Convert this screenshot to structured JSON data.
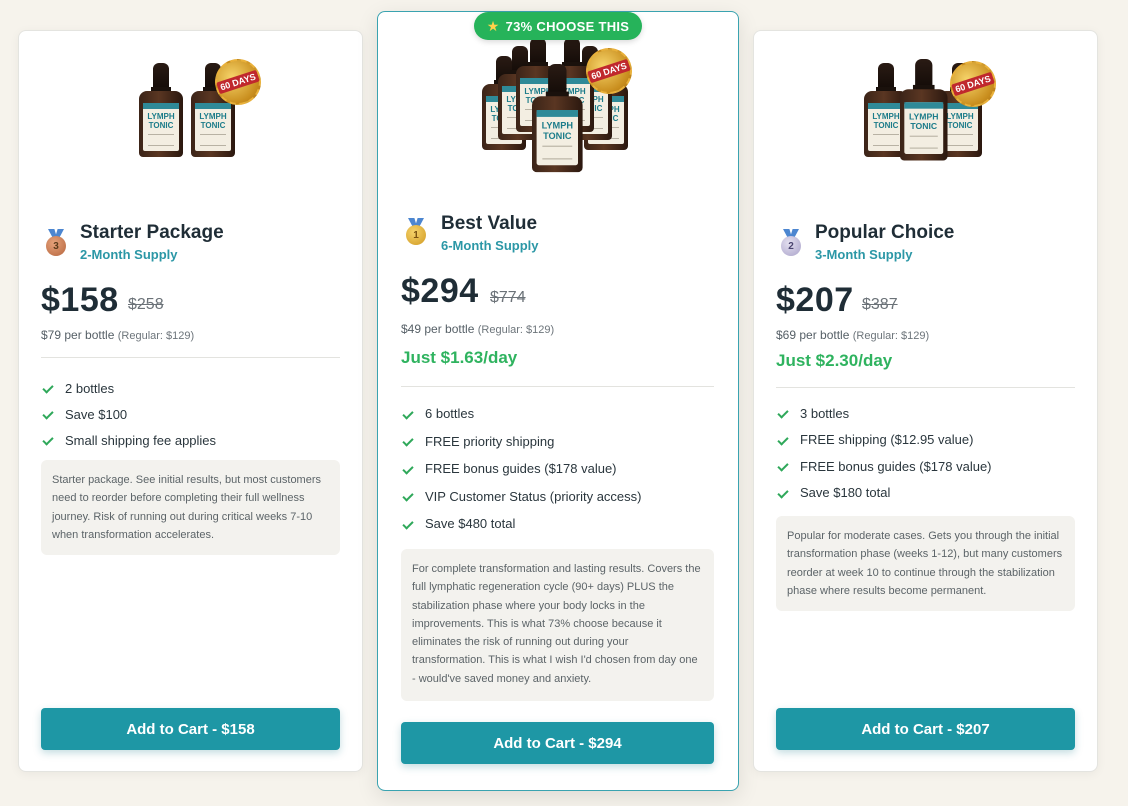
{
  "popular_badge": {
    "icon": "star-icon",
    "label": "73% CHOOSE THIS"
  },
  "bottle_label": {
    "top": "LYMPH",
    "bottom": "TONIC"
  },
  "seal_text": "60 DAYS",
  "colors": {
    "accent": "#1e97a5",
    "highlight_border": "#3aa3b0",
    "green": "#2fb35f",
    "badge": "#26b35a"
  },
  "plans": [
    {
      "medal": "bronze-medal-icon",
      "medal_rank": "3",
      "name": "Starter Package",
      "supply": "2-Month Supply",
      "price": "$158",
      "old_price": "$258",
      "per_bottle": "$79 per bottle",
      "regular": "(Regular: $129)",
      "per_day": "",
      "features": [
        "2 bottles",
        "Save $100",
        "Small shipping fee applies"
      ],
      "note": "Starter package. See initial results, but most customers need to reorder before completing their full wellness journey. Risk of running out during critical weeks 7-10 when transformation accelerates.",
      "cta": "Add to Cart - $158"
    },
    {
      "medal": "gold-medal-icon",
      "medal_rank": "1",
      "name": "Best Value",
      "supply": "6-Month Supply",
      "price": "$294",
      "old_price": "$774",
      "per_bottle": "$49 per bottle",
      "regular": "(Regular: $129)",
      "per_day": "Just $1.63/day",
      "features": [
        "6 bottles",
        "FREE priority shipping",
        "FREE bonus guides ($178 value)",
        "VIP Customer Status (priority access)",
        "Save $480 total"
      ],
      "note": "For complete transformation and lasting results. Covers the full lymphatic regeneration cycle (90+ days) PLUS the stabilization phase where your body locks in the improvements. This is what 73% choose because it eliminates the risk of running out during your transformation. This is what I wish I'd chosen from day one - would've saved money and anxiety.",
      "cta": "Add to Cart - $294"
    },
    {
      "medal": "silver-medal-icon",
      "medal_rank": "2",
      "name": "Popular Choice",
      "supply": "3-Month Supply",
      "price": "$207",
      "old_price": "$387",
      "per_bottle": "$69 per bottle",
      "regular": "(Regular: $129)",
      "per_day": "Just $2.30/day",
      "features": [
        "3 bottles",
        "FREE shipping ($12.95 value)",
        "FREE bonus guides ($178 value)",
        "Save $180 total"
      ],
      "note": "Popular for moderate cases. Gets you through the initial transformation phase (weeks 1-12), but many customers reorder at week 10 to continue through the stabilization phase where results become permanent.",
      "cta": "Add to Cart - $207"
    }
  ]
}
